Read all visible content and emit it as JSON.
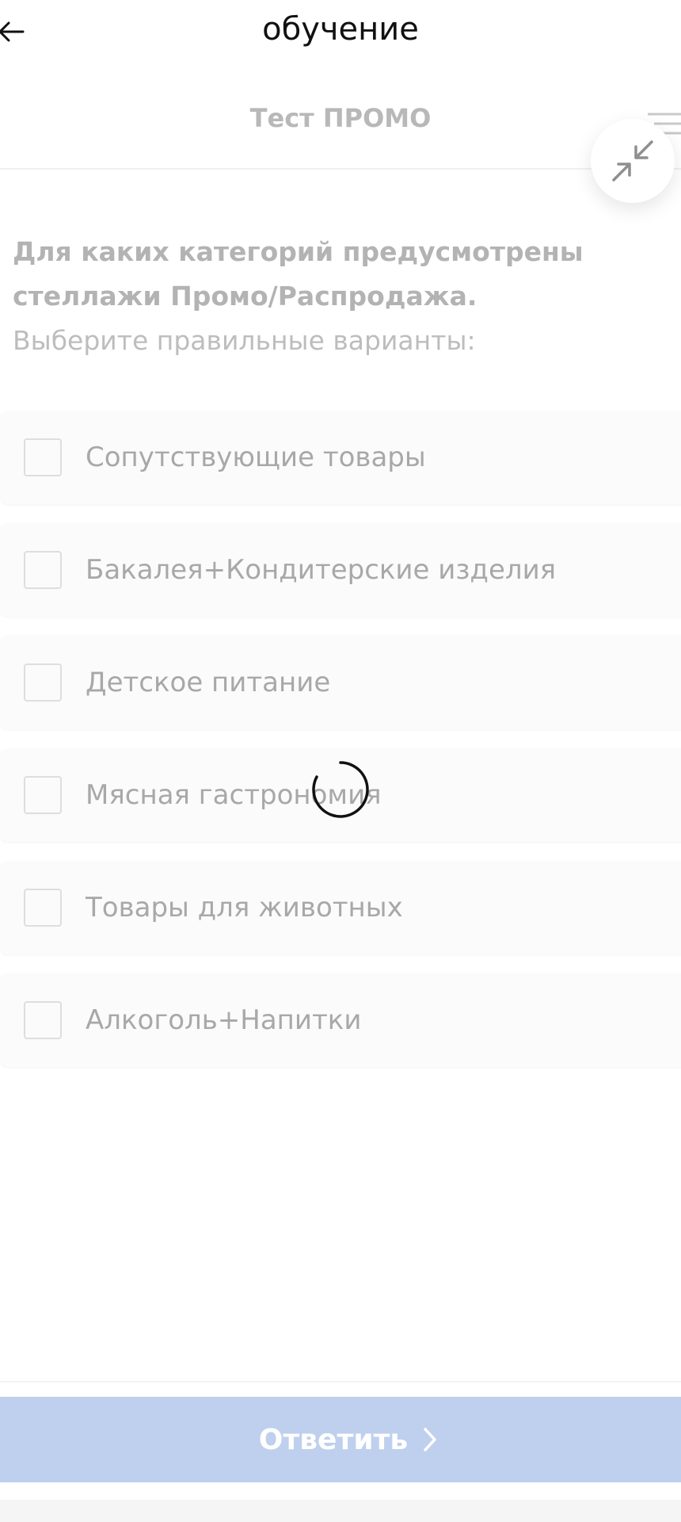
{
  "header": {
    "title": "обучение",
    "back_icon": "arrow-left-icon"
  },
  "test": {
    "title": "Тест ПРОМО",
    "list_icon": "list-icon",
    "collapse_icon": "collapse-arrows-icon"
  },
  "question": {
    "text": "Для каких категорий предусмотрены стеллажи Промо/Распродажа.",
    "instruction": "Выберите правильные варианты:"
  },
  "options": [
    {
      "label": "Сопутствующие товары",
      "checked": false
    },
    {
      "label": "Бакалея+Кондитерские изделия",
      "checked": false
    },
    {
      "label": "Детское питание",
      "checked": false
    },
    {
      "label": "Мясная гастрономия",
      "checked": false
    },
    {
      "label": "Товары для животных",
      "checked": false
    },
    {
      "label": "Алкоголь+Напитки",
      "checked": false
    }
  ],
  "loading_indicator": "spinner-icon",
  "answer_button": {
    "label": "Ответить",
    "icon": "chevron-right-icon",
    "color": "#bfd0ee"
  }
}
